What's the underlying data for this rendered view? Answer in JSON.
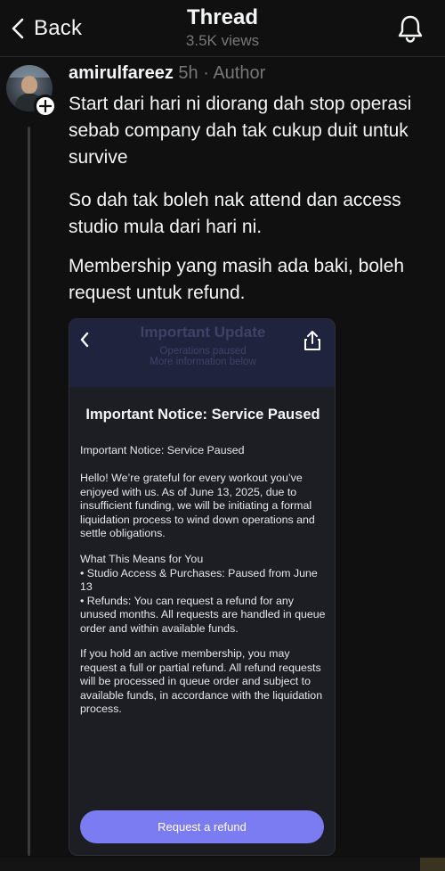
{
  "header": {
    "back_label": "Back",
    "title": "Thread",
    "views": "3.5K views"
  },
  "post": {
    "username": "amirulfareez",
    "time": "5h",
    "separator": " · ",
    "author_badge": "Author",
    "paragraphs": [
      "Start dari hari ni diorang dah stop operasi sebab company dah tak cukup duit untuk survive",
      "So dah tak boleh nak attend dan access studio mula dari hari ni.",
      "Membership yang masih ada baki, boleh request untuk refund."
    ]
  },
  "embedded_screenshot": {
    "top_title": "Important Update",
    "top_subtitle_1": "Operations paused",
    "top_subtitle_2": "More information below",
    "heading": "Important Notice: Service Paused",
    "body_1": "Important Notice: Service Paused",
    "body_2": "Hello! We’re grateful for every workout you’ve enjoyed with us. As of June 13, 2025, due to insufficient funding, we will be initiating a formal liquidation process to wind down operations and settle obligations.",
    "body_3_title": "What This Means for You",
    "body_3_line_1": "• Studio Access & Purchases: Paused from June 13",
    "body_3_line_2": "• Refunds: You can request a refund for any unused months. All requests are handled in queue order and within available funds.",
    "body_4": "If you hold an active membership, you may request a full or partial refund. All refund requests will be processed in queue order and subject to available funds, in accordance with the liquidation process.",
    "button_label": "Request a refund",
    "accent_color": "#7b7cf2"
  },
  "icons": {
    "back": "chevron-left-icon",
    "bell": "bell-icon",
    "follow": "plus-icon",
    "share": "share-icon"
  }
}
